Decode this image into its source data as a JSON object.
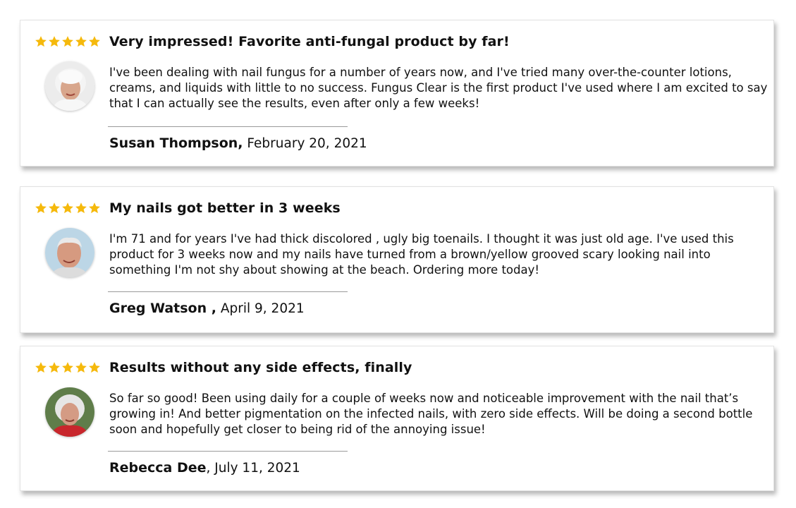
{
  "colors": {
    "star": "#f5b90c",
    "text": "#111111",
    "divider": "#9a9a9a"
  },
  "reviews": [
    {
      "rating": 5,
      "title": "Very impressed! Favorite anti-fungal product by far!",
      "body": "I've been dealing with nail fungus for a number of years now, and I've tried many over-the-counter lotions, creams, and liquids with little to no success. Fungus Clear is the first product I've used where I am excited to say that I can actually see the results, even after only a few weeks!",
      "author": "Susan Thompson,",
      "date": " February 20, 2021",
      "avatar_icon": "elderly-woman-avatar"
    },
    {
      "rating": 5,
      "title": "My nails got better in 3 weeks",
      "body": "I'm 71 and for years I've had thick discolored , ugly big toenails. I thought it was just old age. I've used this product for 3 weeks now and my nails have turned from a brown/yellow grooved scary looking nail into something I'm not shy about showing at the beach. Ordering more today!",
      "author": "Greg Watson ,",
      "date": " April 9, 2021",
      "avatar_icon": "elderly-man-avatar"
    },
    {
      "rating": 5,
      "title": "Results without any side effects, finally",
      "body": "So far so good! Been using daily for a couple of weeks now and noticeable improvement with the nail that’s growing in! And better pigmentation on the infected nails, with zero side effects. Will be doing a second bottle soon and hopefully get closer to being rid of the annoying issue!",
      "author": "Rebecca Dee",
      "date": ", July 11, 2021",
      "avatar_icon": "elderly-woman-avatar"
    }
  ]
}
